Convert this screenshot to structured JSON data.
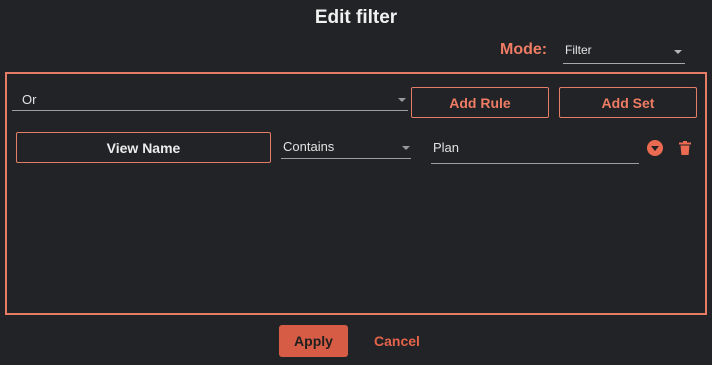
{
  "dialog": {
    "title": "Edit filter"
  },
  "mode": {
    "label": "Mode:",
    "value": "Filter"
  },
  "filter_set": {
    "combinator": "Or",
    "add_rule_label": "Add Rule",
    "add_set_label": "Add Set",
    "rules": [
      {
        "field": "View Name",
        "operator": "Contains",
        "value": "Plan"
      }
    ]
  },
  "footer": {
    "apply_label": "Apply",
    "cancel_label": "Cancel"
  },
  "colors": {
    "background": "#212326",
    "accent": "#e57d66",
    "apply_fill": "#d65c45"
  },
  "icons": {
    "dropdown": "chevron-down-icon",
    "rule_options": "expand-circle-icon",
    "delete": "trash-icon"
  }
}
